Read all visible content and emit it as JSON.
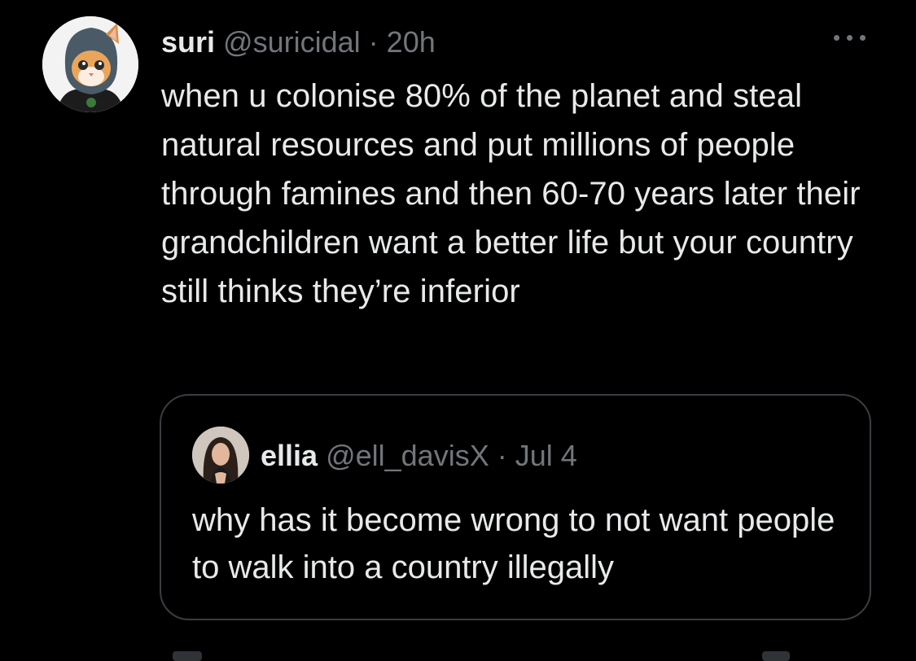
{
  "tweet": {
    "display_name": "suri",
    "handle": "@suricidal",
    "separator": "·",
    "time": "20h",
    "text": "when u colonise 80% of the planet and steal natural resources and put millions of people through famines and then 60-70 years later their grandchildren want a better life but your country still thinks they’re inferior",
    "more_icon": "more-horizontal-icon"
  },
  "quote": {
    "display_name": "ellia",
    "handle": "@ell_davisX",
    "separator": "·",
    "time": "Jul 4",
    "text": "why has it become wrong to not want people to walk into a country illegally"
  },
  "colors": {
    "background": "#000000",
    "primary_text": "#e7e9ea",
    "secondary_text": "#71767b",
    "border": "#3a3d41"
  }
}
